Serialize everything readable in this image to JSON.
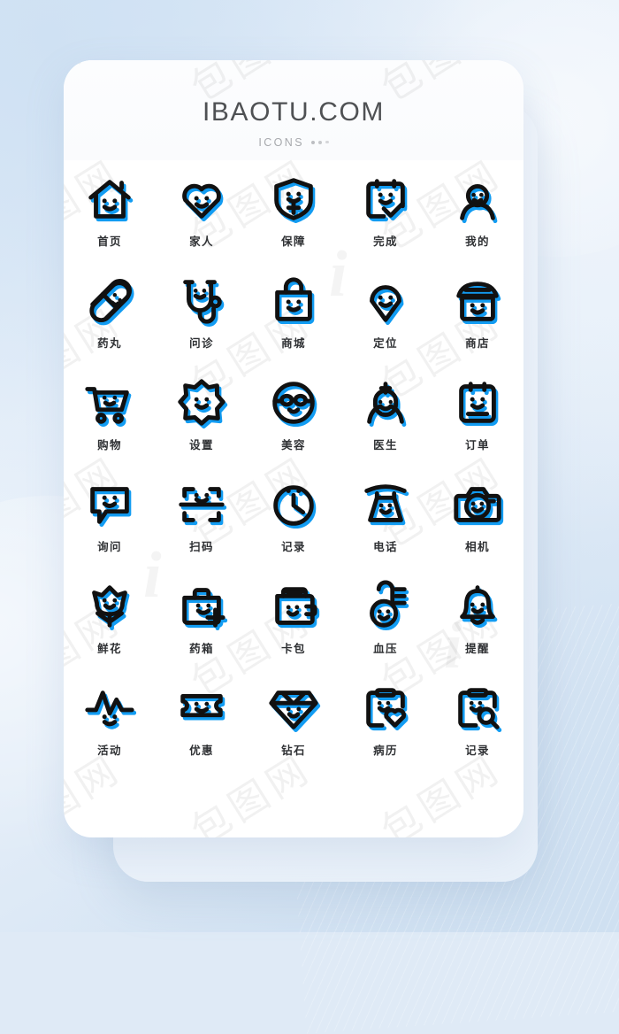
{
  "header": {
    "title": "IBAOTU.COM",
    "subtitle": "ICONS",
    "dots": [
      "dot-1",
      "dot-2",
      "dot-3"
    ]
  },
  "theme": {
    "accent_color": "#129CF2",
    "ink_color": "#111111",
    "card_background": "#FFFFFF",
    "page_background": "#DFEAF6",
    "label_color": "#2E3033",
    "title_color": "#4F5154",
    "subtitle_color": "#A7A9AD"
  },
  "watermark": {
    "text": "包图网",
    "logo": "i"
  },
  "grid": {
    "columns": 5,
    "rows": 6,
    "icons": [
      {
        "label": "首页",
        "icon": "home-smile-icon"
      },
      {
        "label": "家人",
        "icon": "heart-smile-icon"
      },
      {
        "label": "保障",
        "icon": "shield-cross-smile-icon"
      },
      {
        "label": "完成",
        "icon": "clipboard-check-smile-icon"
      },
      {
        "label": "我的",
        "icon": "user-smile-icon"
      },
      {
        "label": "药丸",
        "icon": "pill-smile-icon"
      },
      {
        "label": "问诊",
        "icon": "stethoscope-smile-icon"
      },
      {
        "label": "商城",
        "icon": "shopping-bag-smile-icon"
      },
      {
        "label": "定位",
        "icon": "location-pin-smile-icon"
      },
      {
        "label": "商店",
        "icon": "storefront-smile-icon"
      },
      {
        "label": "购物",
        "icon": "shopping-cart-smile-icon"
      },
      {
        "label": "设置",
        "icon": "gear-smile-icon"
      },
      {
        "label": "美容",
        "icon": "beauty-face-smile-icon"
      },
      {
        "label": "医生",
        "icon": "doctor-smile-icon"
      },
      {
        "label": "订单",
        "icon": "order-clipboard-smile-icon"
      },
      {
        "label": "询问",
        "icon": "chat-bubble-smile-icon"
      },
      {
        "label": "扫码",
        "icon": "qr-scan-smile-icon"
      },
      {
        "label": "记录",
        "icon": "clock-smile-icon"
      },
      {
        "label": "电话",
        "icon": "telephone-smile-icon"
      },
      {
        "label": "相机",
        "icon": "camera-smile-icon"
      },
      {
        "label": "鲜花",
        "icon": "flower-smile-icon"
      },
      {
        "label": "药箱",
        "icon": "medical-kit-smile-icon"
      },
      {
        "label": "卡包",
        "icon": "wallet-smile-icon"
      },
      {
        "label": "血压",
        "icon": "thermometer-smile-icon"
      },
      {
        "label": "提醒",
        "icon": "bell-smile-icon"
      },
      {
        "label": "活动",
        "icon": "pulse-activity-smile-icon"
      },
      {
        "label": "优惠",
        "icon": "coupon-ticket-smile-icon"
      },
      {
        "label": "钻石",
        "icon": "diamond-smile-icon"
      },
      {
        "label": "病历",
        "icon": "medical-record-heart-icon"
      },
      {
        "label": "记录",
        "icon": "record-search-clipboard-icon"
      }
    ]
  }
}
